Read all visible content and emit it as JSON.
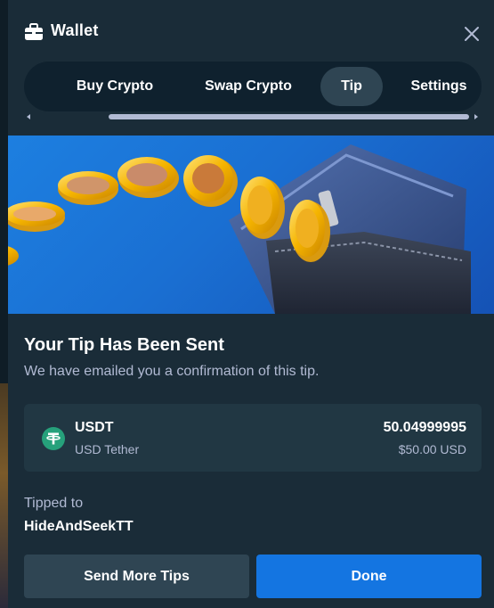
{
  "header": {
    "title": "Wallet",
    "icons": {
      "wallet": "wallet-icon",
      "close": "close-icon"
    }
  },
  "tabs": [
    {
      "label": "Buy Crypto",
      "active": false
    },
    {
      "label": "Swap Crypto",
      "active": false
    },
    {
      "label": "Tip",
      "active": true
    },
    {
      "label": "Settings",
      "active": false
    }
  ],
  "confirmation": {
    "heading": "Your Tip Has Been Sent",
    "subtext": "We have emailed you a confirmation of this tip."
  },
  "currency": {
    "code": "USDT",
    "name": "USD Tether",
    "amount": "50.04999995",
    "usd_value": "$50.00 USD",
    "icon": "tether-icon"
  },
  "recipient": {
    "label": "Tipped to",
    "username": "HideAndSeekTT"
  },
  "buttons": {
    "send_more": "Send More Tips",
    "done": "Done"
  },
  "colors": {
    "background": "#1a2c38",
    "tabs_bg": "#0f212e",
    "active_tab": "#2f4553",
    "card_bg": "#213743",
    "muted_text": "#b1bad3",
    "primary_button": "#1475e1",
    "tether_green": "#26a17b"
  }
}
